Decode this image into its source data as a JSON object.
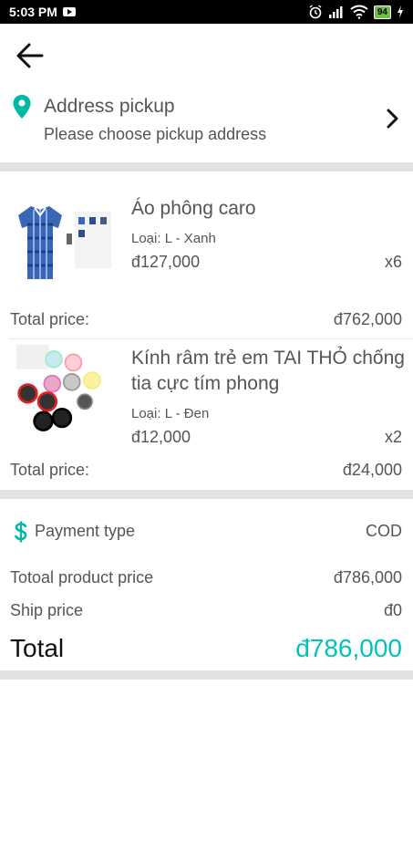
{
  "status_bar": {
    "time": "5:03 PM",
    "battery": "94",
    "icons": [
      "youtube-icon",
      "alarm-icon",
      "signal-icon",
      "wifi-icon",
      "battery-icon",
      "charging-icon"
    ]
  },
  "colors": {
    "accent": "#00c4bc",
    "divider": "#e2e2e2",
    "text": "#555555"
  },
  "address": {
    "title": "Address pickup",
    "subtitle": "Please choose pickup address"
  },
  "products": [
    {
      "name": "Áo phông caro",
      "variant": "Loại: L - Xanh",
      "price": "đ127,000",
      "quantity": "x6",
      "total_label": "Total price:",
      "total_value": "đ762,000"
    },
    {
      "name": "Kính râm trẻ em TAI THỎ chống tia cực tím phong",
      "variant": "Loại: L - Đen",
      "price": "đ12,000",
      "quantity": "x2",
      "total_label": "Total price:",
      "total_value": "đ24,000"
    }
  ],
  "payment": {
    "label": "Payment type",
    "value": "COD"
  },
  "summary": {
    "product_price_label": "Totoal product price",
    "product_price_value": "đ786,000",
    "ship_label": "Ship price",
    "ship_value": "đ0",
    "total_label": "Total",
    "total_value": "đ786,000"
  }
}
